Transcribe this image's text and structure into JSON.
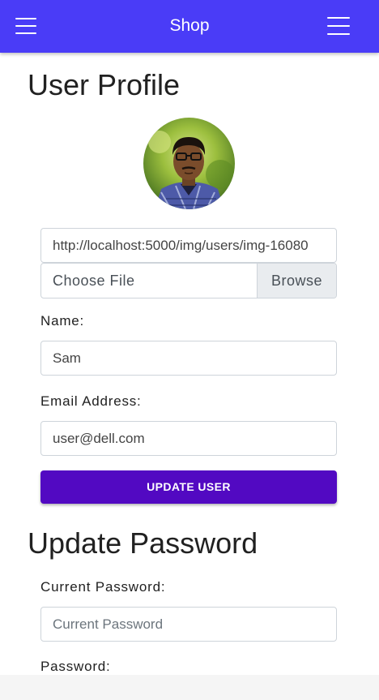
{
  "appbar": {
    "title": "Shop",
    "left_icon": "menu-icon",
    "right_icon": "menu-icon"
  },
  "profile": {
    "heading": "User Profile",
    "image_url": "http://localhost:5000/img/users/img-16080",
    "file_label": "Choose File",
    "browse_label": "Browse",
    "name_label": "Name:",
    "name_value": "Sam",
    "email_label": "Email Address:",
    "email_value": "user@dell.com",
    "update_button": "UPDATE USER"
  },
  "password": {
    "heading": "Update Password",
    "current_label": "Current Password:",
    "current_placeholder": "Current Password",
    "password_label": "Password:"
  },
  "colors": {
    "appbar": "#4a3cf7",
    "button": "#5209c2"
  }
}
